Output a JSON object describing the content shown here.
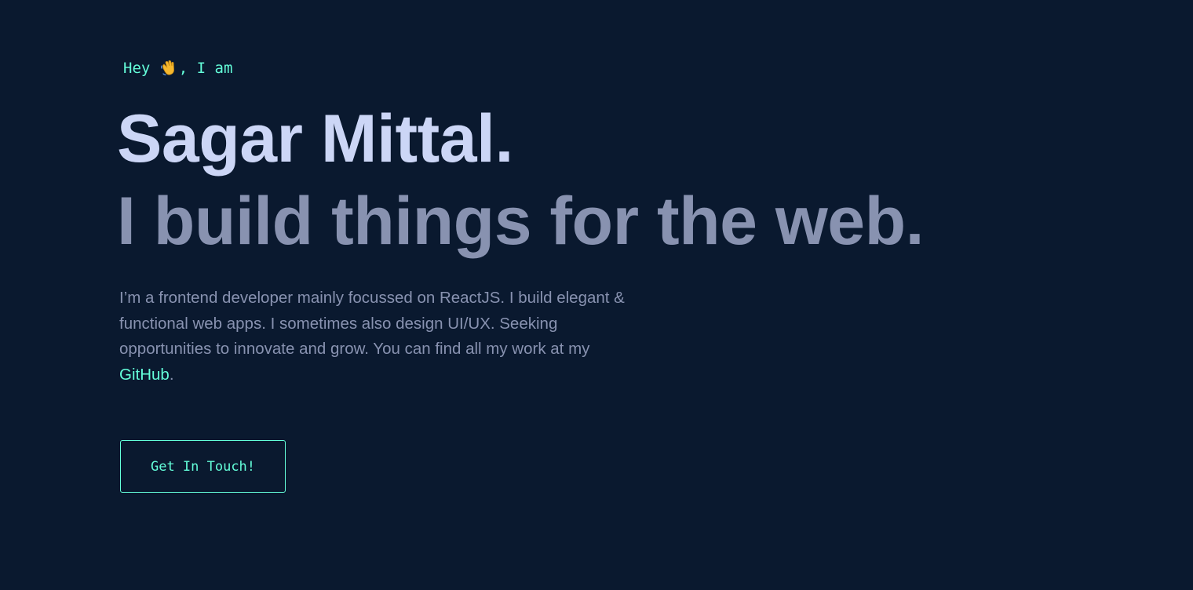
{
  "hero": {
    "greeting_prefix": "Hey ",
    "greeting_icon": "waving-hand-icon",
    "greeting_suffix": ", I am",
    "name": "Sagar Mittal.",
    "tagline": "I build things for the web.",
    "bio_text": "I’m a frontend developer mainly focussed on ReactJS. I build elegant & functional web apps. I sometimes also design UI/UX. Seeking opportunities to innovate and grow. You can find all my work at my ",
    "bio_link": "GitHub",
    "bio_end": ".",
    "cta_label": "Get In Touch!"
  },
  "colors": {
    "background": "#0a192f",
    "accent": "#64ffda",
    "heading": "#ccd6f6",
    "muted": "#8892b0"
  }
}
